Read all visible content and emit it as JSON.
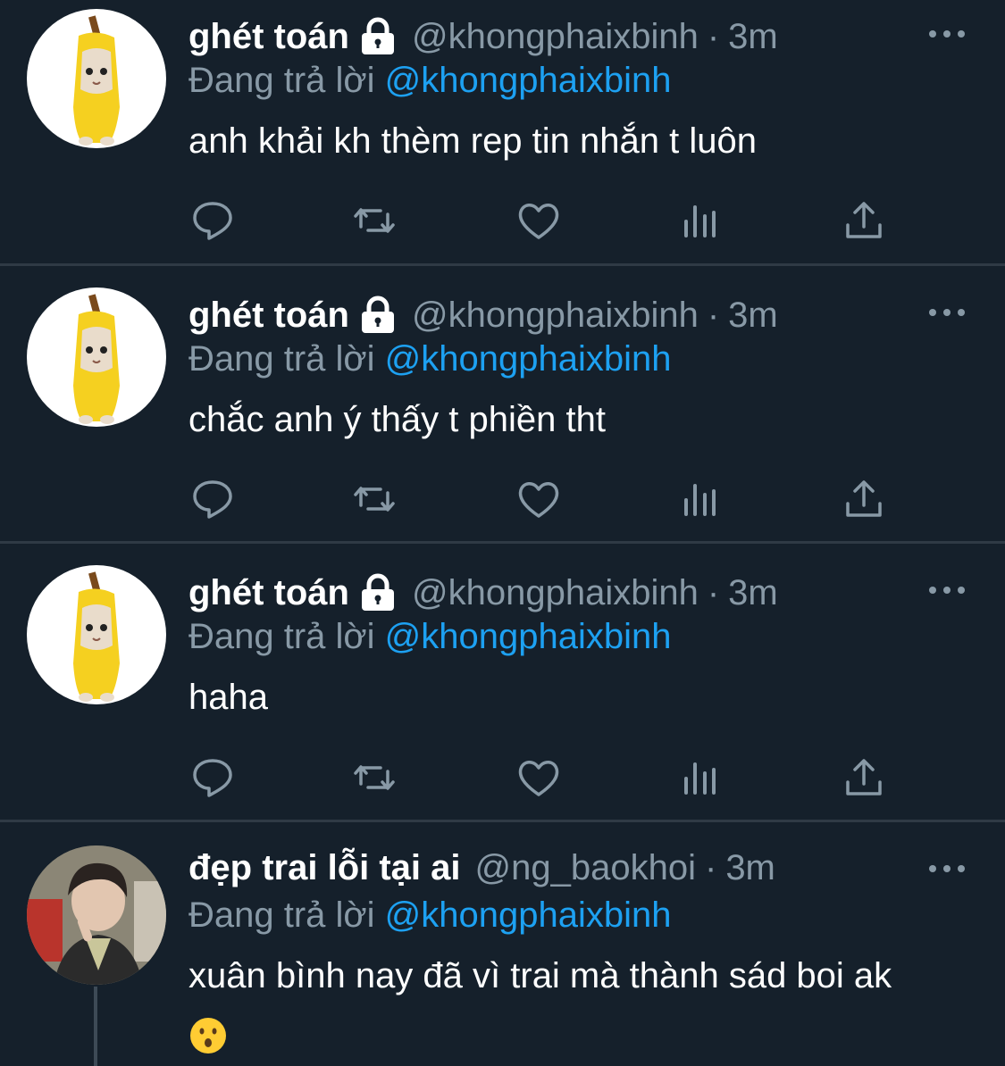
{
  "tweets": [
    {
      "name": "ghét toán",
      "locked": true,
      "handle": "@khongphaixbinh",
      "separator": "·",
      "time": "3m",
      "reply_prefix": "Đang trả lời",
      "reply_to": "@khongphaixbinh",
      "text": "anh khải kh thèm rep tin nhắn t luôn",
      "avatar": "banana-cat"
    },
    {
      "name": "ghét toán",
      "locked": true,
      "handle": "@khongphaixbinh",
      "separator": "·",
      "time": "3m",
      "reply_prefix": "Đang trả lời",
      "reply_to": "@khongphaixbinh",
      "text": "chắc anh ý thấy t phiền tht",
      "avatar": "banana-cat"
    },
    {
      "name": "ghét toán",
      "locked": true,
      "handle": "@khongphaixbinh",
      "separator": "·",
      "time": "3m",
      "reply_prefix": "Đang trả lời",
      "reply_to": "@khongphaixbinh",
      "text": "haha",
      "avatar": "banana-cat"
    },
    {
      "name": "đẹp trai lỗi tại ai",
      "locked": false,
      "handle": "@ng_baokhoi",
      "separator": "·",
      "time": "3m",
      "reply_prefix": "Đang trả lời",
      "reply_to": "@khongphaixbinh",
      "text": "xuân bình nay đã vì trai mà thành sád boi ak",
      "emoji": "hushed-face",
      "avatar": "profile-photo"
    }
  ],
  "actions": [
    "reply-icon",
    "retweet-icon",
    "like-icon",
    "analytics-icon",
    "share-icon"
  ],
  "colors": {
    "background": "#15202b",
    "secondary_text": "#8899a6",
    "link": "#1da1f2",
    "divider": "#2f3a45"
  }
}
